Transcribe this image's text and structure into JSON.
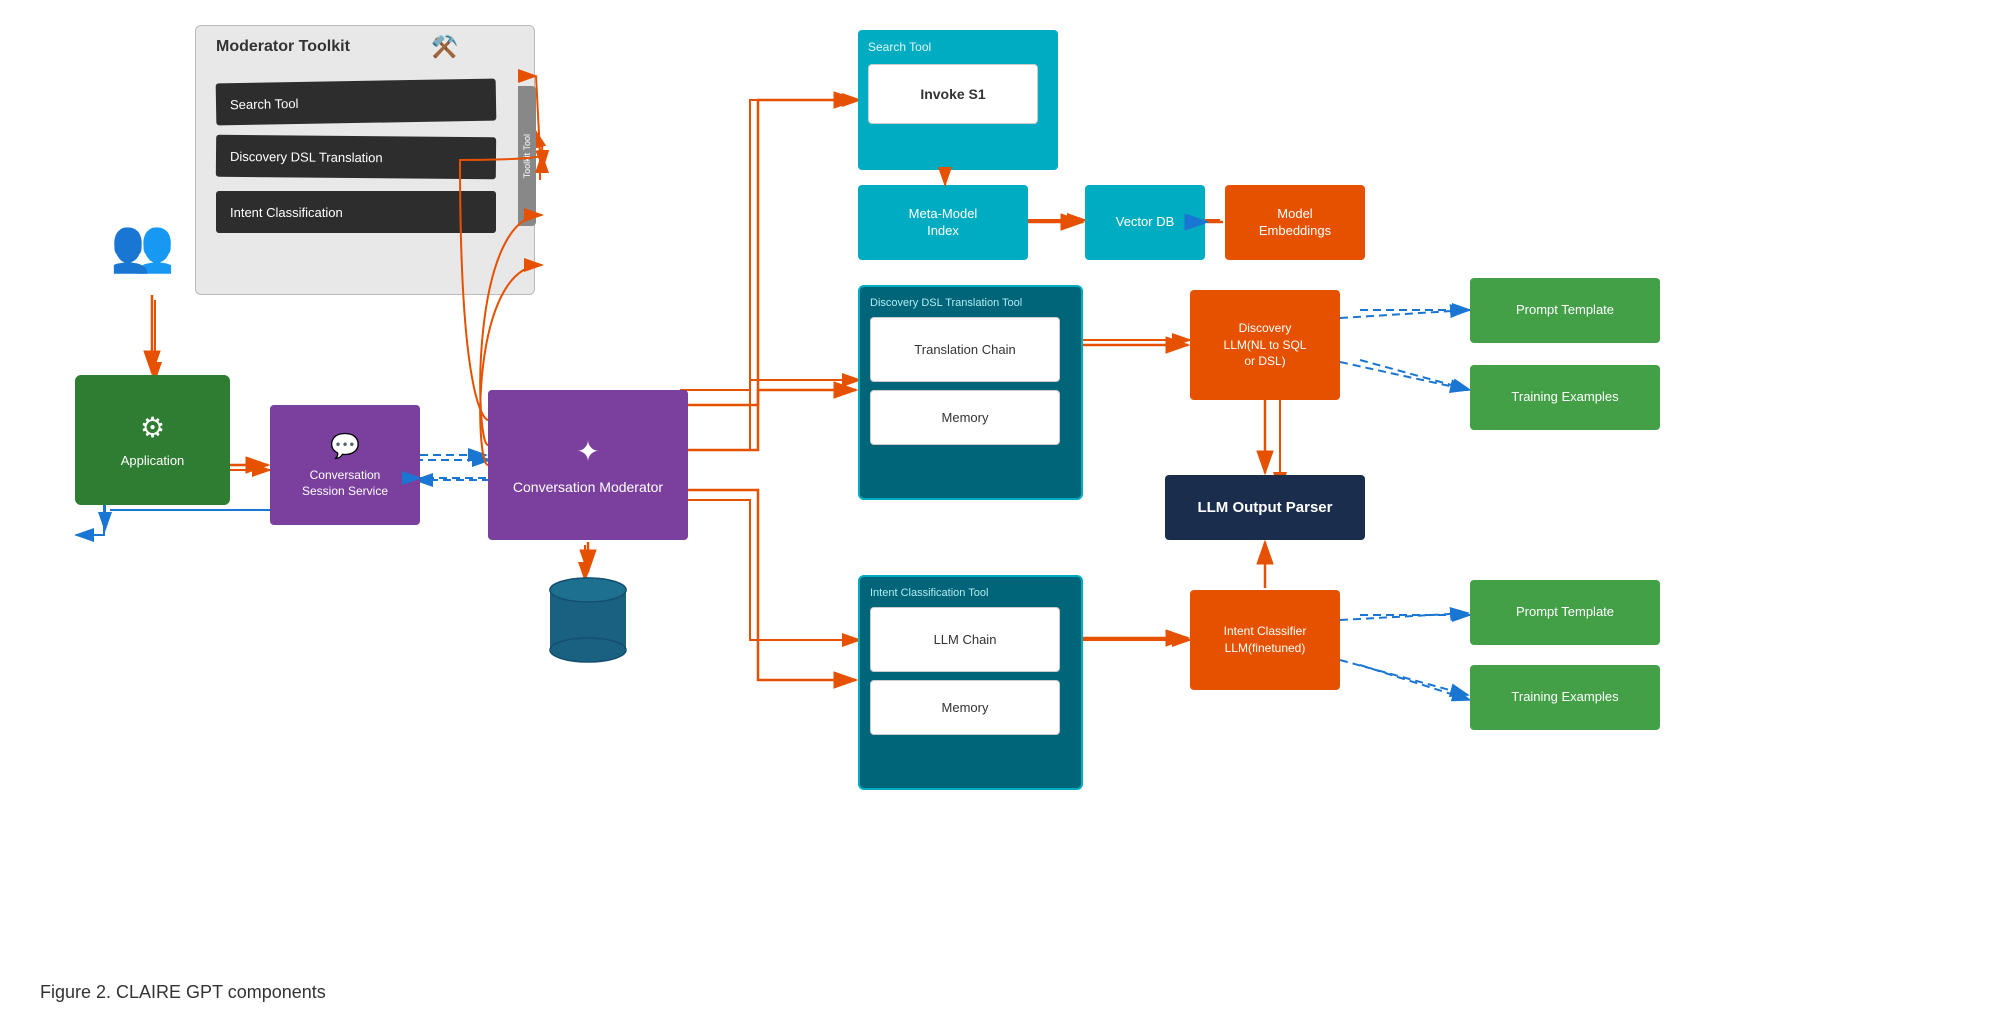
{
  "caption": "Figure 2. CLAIRE GPT components",
  "toolkit": {
    "title": "Moderator Toolkit",
    "icon": "⚒",
    "cards": [
      {
        "label": "Search Tool"
      },
      {
        "label": "Discovery DSL Translation"
      },
      {
        "label": "Intent Classification"
      }
    ]
  },
  "nodes": {
    "application": {
      "label": "Application"
    },
    "conversation_session": {
      "label": "Conversation\nSession Service"
    },
    "conversation_moderator": {
      "label": "Conversation Moderator"
    },
    "search_tool_header": {
      "label": "Search Tool"
    },
    "invoke_s1": {
      "label": "Invoke S1"
    },
    "meta_model_index": {
      "label": "Meta-Model\nIndex"
    },
    "vector_db": {
      "label": "Vector DB"
    },
    "model_embeddings": {
      "label": "Model\nEmbeddings"
    },
    "translation_chain": {
      "label": "Translation Chain"
    },
    "memory_dsl": {
      "label": "Memory"
    },
    "dsl_tool_label": {
      "label": "Discovery DSL\nTranslation Tool"
    },
    "discovery_llm": {
      "label": "Discovery\nLLM(NL to SQL\nor DSL)"
    },
    "prompt_template_1": {
      "label": "Prompt Template"
    },
    "training_examples_1": {
      "label": "Training Examples"
    },
    "llm_output_parser": {
      "label": "LLM Output Parser"
    },
    "intent_tool_label": {
      "label": "Intent Classification\nTool"
    },
    "llm_chain": {
      "label": "LLM Chain"
    },
    "memory_intent": {
      "label": "Memory"
    },
    "intent_classifier_llm": {
      "label": "Intent Classifier\nLLM(finetuned)"
    },
    "prompt_template_2": {
      "label": "Prompt Template"
    },
    "training_examples_2": {
      "label": "Training Examples"
    }
  }
}
